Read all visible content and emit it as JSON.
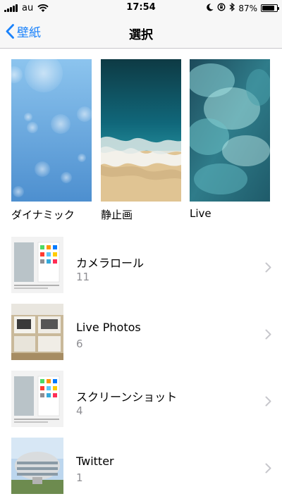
{
  "status_bar": {
    "carrier": "au",
    "time": "17:54",
    "battery_percent": "87%",
    "battery_level": 0.87,
    "icons": [
      "signal-icon",
      "wifi-icon",
      "moon-icon",
      "rotation-lock-icon",
      "bluetooth-icon",
      "battery-icon"
    ]
  },
  "nav": {
    "back_label": "壁紙",
    "title": "選択"
  },
  "categories": [
    {
      "label": "ダイナミック"
    },
    {
      "label": "静止画"
    },
    {
      "label": "Live"
    }
  ],
  "albums": [
    {
      "name": "カメラロール",
      "count": "11"
    },
    {
      "name": "Live Photos",
      "count": "6"
    },
    {
      "name": "スクリーンショット",
      "count": "4"
    },
    {
      "name": "Twitter",
      "count": "1"
    }
  ],
  "colors": {
    "accent": "#1a82fb",
    "secondary_text": "#8e8e93",
    "bar_background": "#f7f7f7"
  }
}
